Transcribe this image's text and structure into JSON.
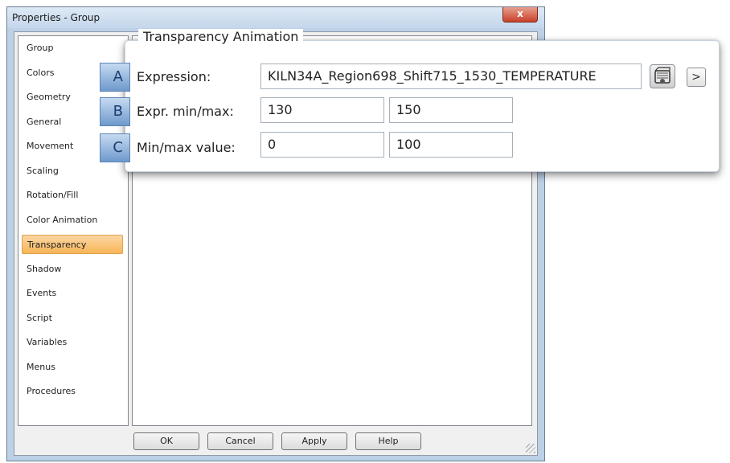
{
  "window": {
    "title": "Properties - Group",
    "close_glyph": "x"
  },
  "nav": {
    "items": [
      {
        "label": "Group"
      },
      {
        "label": "Colors"
      },
      {
        "label": "Geometry"
      },
      {
        "label": "General"
      },
      {
        "label": "Movement"
      },
      {
        "label": "Scaling"
      },
      {
        "label": "Rotation/Fill"
      },
      {
        "label": "Color Animation"
      },
      {
        "label": "Transparency",
        "selected": true
      },
      {
        "label": "Shadow"
      },
      {
        "label": "Events"
      },
      {
        "label": "Script"
      },
      {
        "label": "Variables"
      },
      {
        "label": "Menus"
      },
      {
        "label": "Procedures"
      }
    ]
  },
  "buttons": {
    "ok": "OK",
    "cancel": "Cancel",
    "apply": "Apply",
    "help": "Help"
  },
  "callout": {
    "title": "Transparency Animation",
    "rows": [
      {
        "badge": "A",
        "label": "Expression:",
        "value": "KILN34A_Region698_Shift715_1530_TEMPERATURE"
      },
      {
        "badge": "B",
        "label": "Expr. min/max:",
        "min": "130",
        "max": "150"
      },
      {
        "badge": "C",
        "label": "Min/max value:",
        "min": "0",
        "max": "100"
      }
    ],
    "browse_icon": "tag-browse-icon",
    "arrow_glyph": ">"
  },
  "colors": {
    "selected_item": "#f7b557",
    "badge": "#6e99cc",
    "close_button": "#c8412b"
  }
}
